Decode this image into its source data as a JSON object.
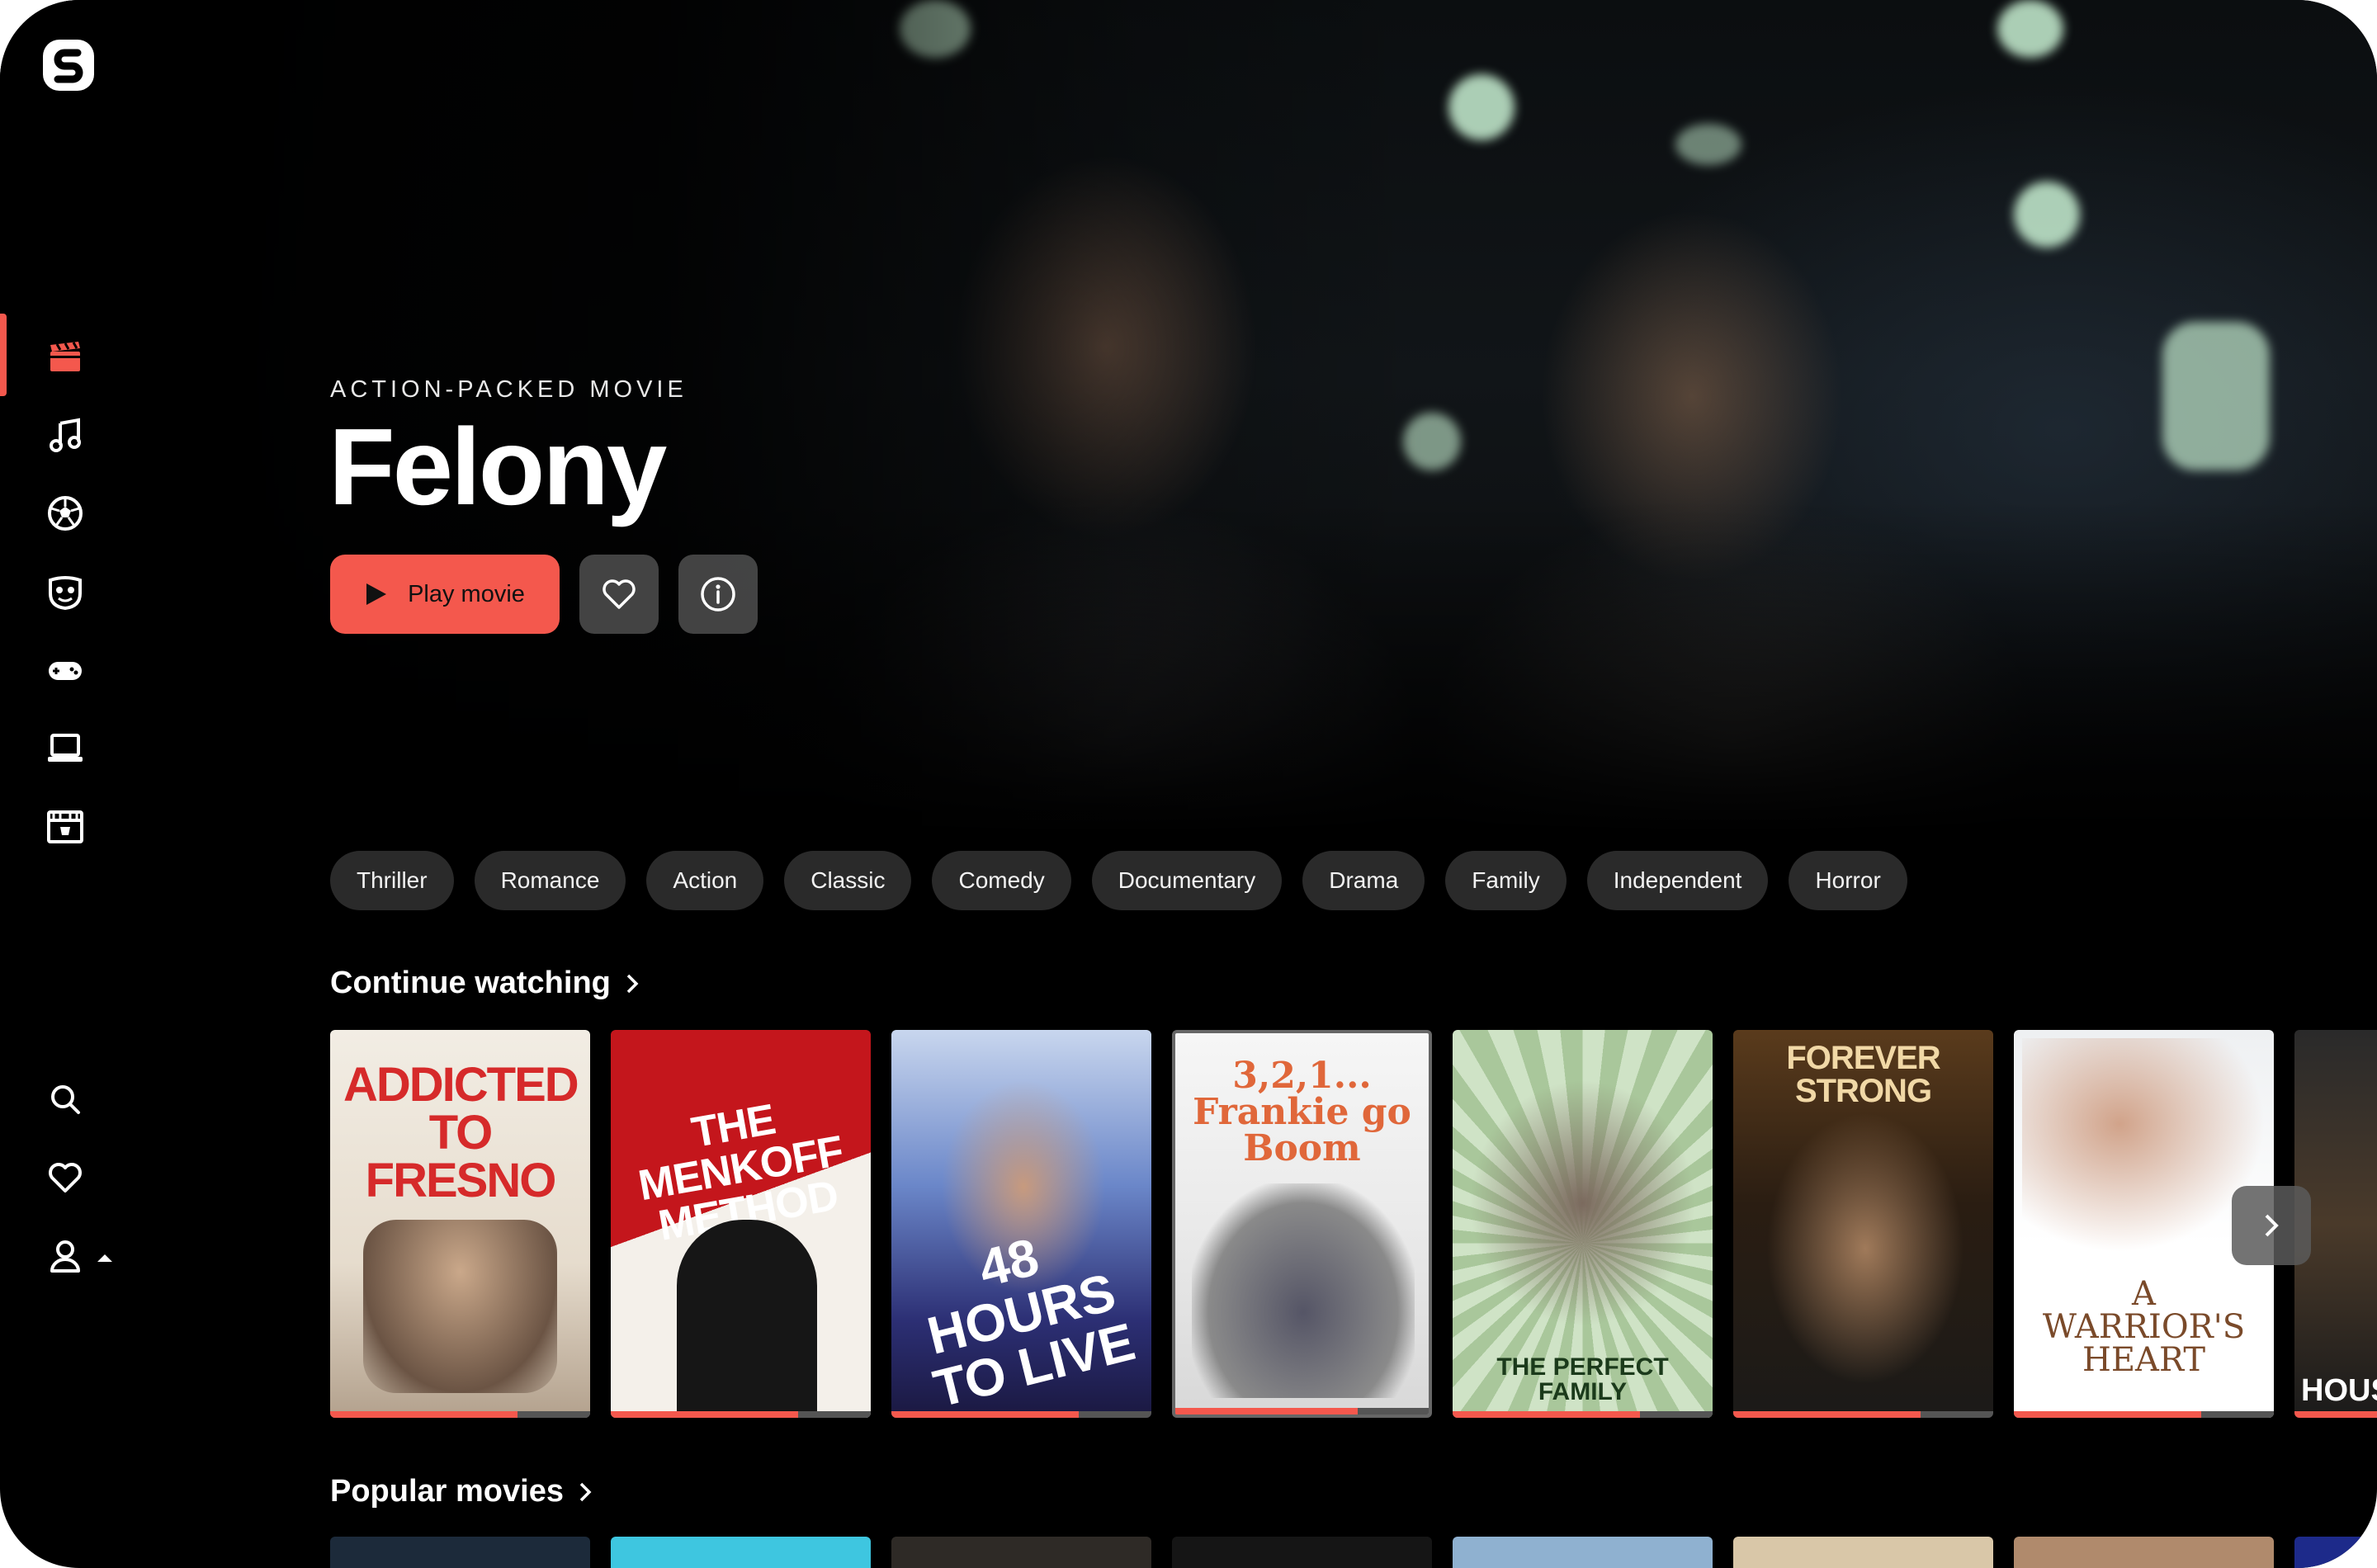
{
  "hero": {
    "kicker": "ACTION-PACKED MOVIE",
    "title": "Felony",
    "play_label": "Play movie"
  },
  "sidebar": {
    "items": [
      {
        "name": "movies",
        "icon": "clapperboard-icon",
        "active": true
      },
      {
        "name": "music",
        "icon": "music-note-icon",
        "active": false
      },
      {
        "name": "sports",
        "icon": "soccer-ball-icon",
        "active": false
      },
      {
        "name": "kids",
        "icon": "kids-mask-icon",
        "active": false
      },
      {
        "name": "games",
        "icon": "gamepad-icon",
        "active": false
      },
      {
        "name": "tv",
        "icon": "laptop-icon",
        "active": false
      },
      {
        "name": "theater",
        "icon": "theater-icon",
        "active": false
      }
    ],
    "bottom": [
      {
        "name": "search",
        "icon": "search-icon"
      },
      {
        "name": "favorites",
        "icon": "heart-icon"
      },
      {
        "name": "profile",
        "icon": "user-icon"
      }
    ]
  },
  "genres": [
    "Thriller",
    "Romance",
    "Action",
    "Classic",
    "Comedy",
    "Documentary",
    "Drama",
    "Family",
    "Independent",
    "Horror"
  ],
  "sections": {
    "continue_watching": "Continue watching",
    "popular_movies": "Popular movies"
  },
  "continue_watching": [
    {
      "title": "ADDICTED TO FRESNO",
      "progress": 0.72
    },
    {
      "title": "THE MENKOFF METHOD",
      "progress": 0.72
    },
    {
      "title": "48 HOURS TO LIVE",
      "progress": 0.72
    },
    {
      "title": "3,2,1... Frankie go Boom",
      "progress": 0.72
    },
    {
      "title": "THE PERFECT FAMILY",
      "progress": 0.72
    },
    {
      "title": "FOREVER STRONG",
      "progress": 0.72
    },
    {
      "title": "A WARRIOR'S HEART",
      "progress": 0.72
    },
    {
      "title": "HOUS",
      "progress": 1.0
    }
  ],
  "colors": {
    "accent": "#f4584d",
    "chip_bg": "#2a2a2a",
    "background": "#000000"
  }
}
